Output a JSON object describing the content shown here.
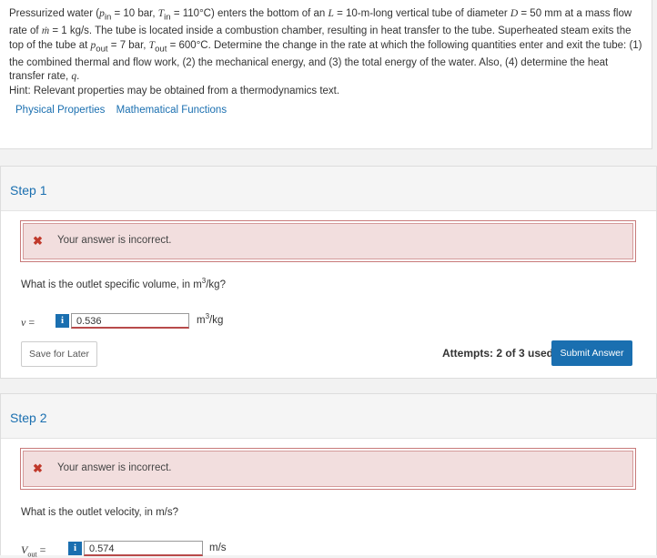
{
  "problem": {
    "t1": "Pressurized water (",
    "p_in": "p",
    "p_in_sub": "in",
    "t2": " = 10 bar, ",
    "t_in": "T",
    "t_in_sub": "in",
    "t3": " = 110°C) enters the bottom of an ",
    "l": "L",
    "t4": " = 10-m-long vertical tube of diameter ",
    "d": "D",
    "t5": " = 50 mm at a mass flow rate of ",
    "m": "ṁ",
    "t6": " = 1 kg/s. The tube is located inside a combustion chamber, resulting in heat transfer to the tube. Superheated steam exits the top of the tube at ",
    "p_out": "p",
    "p_out_sub": "out",
    "t7": " = 7 bar, ",
    "t_out": "T",
    "t_out_sub": "out",
    "t8": " = 600°C. Determine the change in the rate at which the following quantities enter and exit the tube: (1) the combined thermal and flow work, (2) the mechanical energy, and (3) the total energy of the water. Also, (4) determine the heat transfer rate, ",
    "q": "q",
    "t9": ".",
    "hint": "Hint: Relevant properties may be obtained from a thermodynamics text.",
    "links": [
      "Physical Properties",
      "Mathematical Functions"
    ]
  },
  "step1": {
    "title": "Step 1",
    "alert_icon": "✖",
    "alert": "Your answer is incorrect.",
    "question_pre": "What is the outlet specific volume, in m",
    "question_sup": "3",
    "question_post": "/kg?",
    "var": "v",
    "eq": " =",
    "info": "i",
    "value": "0.536",
    "unit_pre": "m",
    "unit_sup": "3",
    "unit_post": "/kg",
    "save": "Save for Later",
    "attempts": "Attempts: 2 of 3 used",
    "submit": "Submit Answer"
  },
  "step2": {
    "title": "Step 2",
    "alert_icon": "✖",
    "alert": "Your answer is incorrect.",
    "question": "What is the outlet velocity, in m/s?",
    "var": "V",
    "var_sub": "out",
    "eq": " =",
    "info": "i",
    "value": "0.574",
    "unit": "m/s"
  },
  "colors": {
    "accent": "#1a6fb0",
    "error_bg": "#f2dede",
    "error_icon": "#c0392b"
  }
}
